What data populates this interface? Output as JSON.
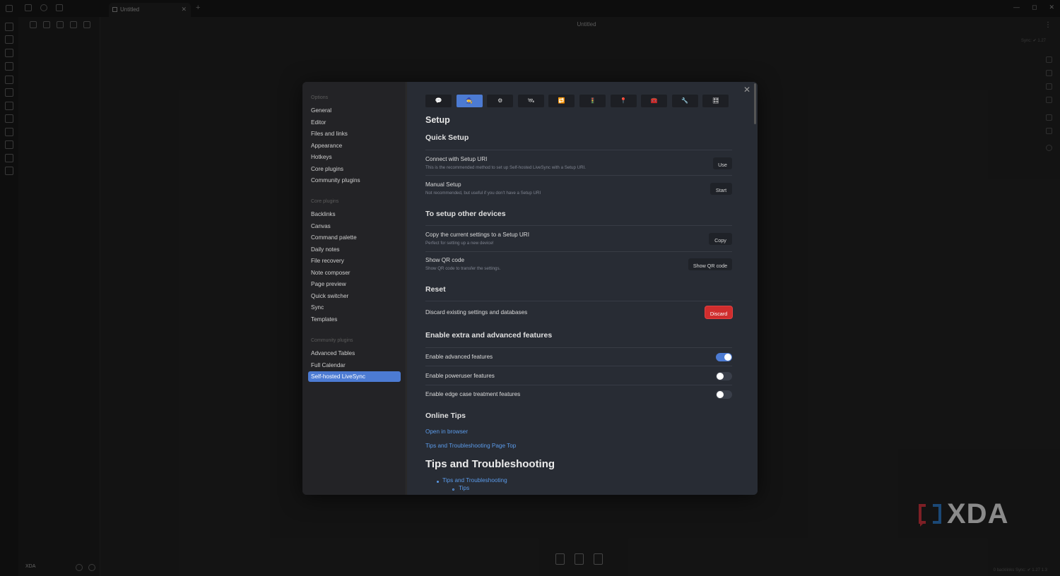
{
  "window": {
    "tab_title": "Untitled",
    "tab_close": "✕",
    "new_tab": "+",
    "note_title": "Untitled",
    "more_menu": "⋮",
    "sync_status_top": "Sync: ✔ 1.27",
    "min": "—",
    "max": "◻",
    "close": "✕"
  },
  "sidepanel_footer": {
    "vault_name": "XDA"
  },
  "status_bar": {
    "text": "0 backlinks   Sync: ✔ 1.27 1.3"
  },
  "modal": {
    "close_label": "✕",
    "sidebar": {
      "groups": [
        {
          "title": "Options",
          "items": [
            "General",
            "Editor",
            "Files and links",
            "Appearance",
            "Hotkeys",
            "Core plugins",
            "Community plugins"
          ]
        },
        {
          "title": "Core plugins",
          "items": [
            "Backlinks",
            "Canvas",
            "Command palette",
            "Daily notes",
            "File recovery",
            "Note composer",
            "Page preview",
            "Quick switcher",
            "Sync",
            "Templates"
          ]
        },
        {
          "title": "Community plugins",
          "items": [
            "Advanced Tables",
            "Full Calendar",
            "Self-hosted LiveSync"
          ]
        }
      ],
      "active_item": "Self-hosted LiveSync"
    },
    "plugin_tabs": [
      {
        "icon": "💬",
        "icon_name": "speech-bubble-icon"
      },
      {
        "icon": "🧙",
        "icon_name": "wizard-icon"
      },
      {
        "icon": "⚙",
        "icon_name": "gear-icon"
      },
      {
        "icon": "🛰",
        "icon_name": "satellite-icon"
      },
      {
        "icon": "🔁",
        "icon_name": "repeat-icon"
      },
      {
        "icon": "🚦",
        "icon_name": "traffic-light-icon"
      },
      {
        "icon": "📍",
        "icon_name": "pin-icon"
      },
      {
        "icon": "🧰",
        "icon_name": "toolbox-icon"
      },
      {
        "icon": "🔧",
        "icon_name": "wrench-icon"
      },
      {
        "icon": "🎛",
        "icon_name": "control-panel-icon"
      }
    ],
    "active_tab_index": 1,
    "content": {
      "title": "Setup",
      "quick_setup": {
        "heading": "Quick Setup",
        "rows": [
          {
            "name": "Connect with Setup URI",
            "desc": "This is the recommended method to set up Self-hosted LiveSync with a Setup URI.",
            "button": "Use"
          },
          {
            "name": "Manual Setup",
            "desc": "Not recommended, but useful if you don't have a Setup URI",
            "button": "Start"
          }
        ]
      },
      "other_devices": {
        "heading": "To setup other devices",
        "rows": [
          {
            "name": "Copy the current settings to a Setup URI",
            "desc": "Perfect for setting up a new device!",
            "button": "Copy"
          },
          {
            "name": "Show QR code",
            "desc": "Show QR code to transfer the settings.",
            "button": "Show QR code"
          }
        ]
      },
      "reset": {
        "heading": "Reset",
        "row": {
          "name": "Discard existing settings and databases",
          "button": "Discard"
        }
      },
      "extra": {
        "heading": "Enable extra and advanced features",
        "toggles": [
          {
            "name": "Enable advanced features",
            "on": true
          },
          {
            "name": "Enable poweruser features",
            "on": false
          },
          {
            "name": "Enable edge case treatment features",
            "on": false
          }
        ]
      },
      "online_tips": {
        "heading": "Online Tips",
        "links": [
          "Open in browser",
          "Tips and Troubleshooting Page Top"
        ]
      },
      "troubleshooting": {
        "heading": "Tips and Troubleshooting",
        "bullets": [
          "Tips and Troubleshooting"
        ],
        "sub_bullets": [
          "Tips"
        ]
      }
    }
  },
  "colors": {
    "accent": "#4c7bd3",
    "danger": "#d02d2d",
    "link": "#5b9bea",
    "modal_bg": "#282c34"
  }
}
